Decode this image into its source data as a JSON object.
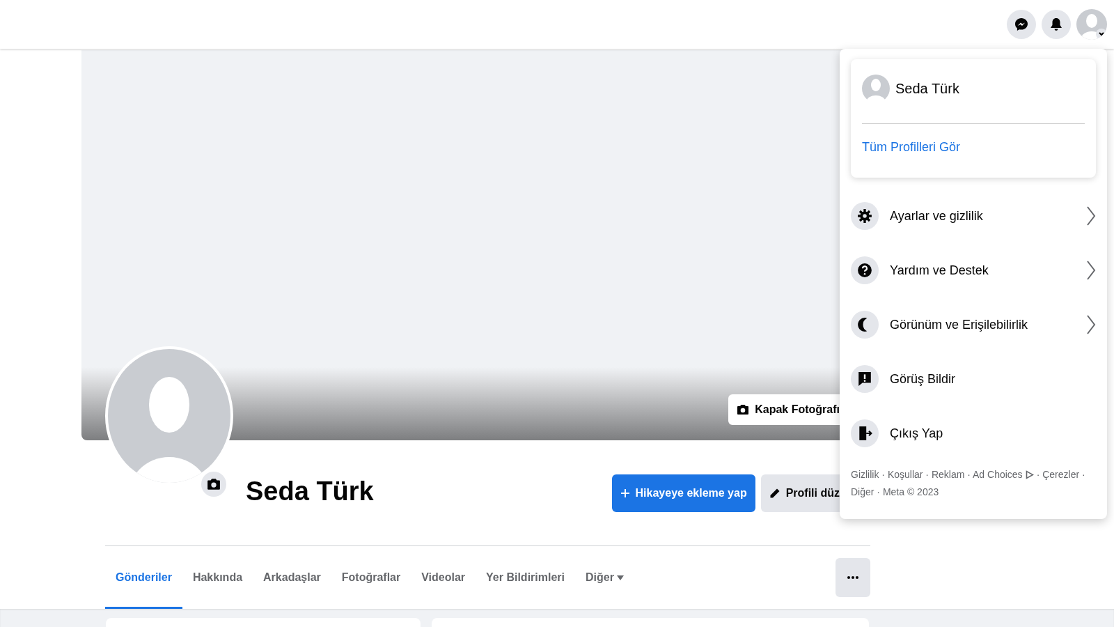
{
  "cover": {
    "button": "Kapak Fotoğrafı"
  },
  "profile": {
    "name": "Seda Türk",
    "buttons": [
      {
        "kind": "primary",
        "label": "Hikayeye ekleme yap"
      },
      {
        "kind": "secondary",
        "label": "Profili düz"
      }
    ]
  },
  "tabs": [
    {
      "label": "Gönderiler",
      "selected": true
    },
    {
      "label": "Hakkında",
      "selected": false
    },
    {
      "label": "Arkadaşlar",
      "selected": false
    },
    {
      "label": "Fotoğraflar",
      "selected": false
    },
    {
      "label": "Videolar",
      "selected": false
    },
    {
      "label": "Yer Bildirimleri",
      "selected": false
    },
    {
      "label": "Diğer",
      "selected": false,
      "dropdown": true
    }
  ],
  "account_menu": {
    "profile_name": "Seda Türk",
    "see_all": "Tüm Profilleri Gör",
    "items": [
      {
        "label": "Ayarlar ve gizlilik",
        "kind": "settings",
        "submenu": true
      },
      {
        "label": "Yardım ve Destek",
        "kind": "help",
        "submenu": true
      },
      {
        "label": "Görünüm ve Erişilebilirlik",
        "kind": "display",
        "submenu": true
      },
      {
        "label": "Görüş Bildir",
        "kind": "feedback",
        "submenu": false
      },
      {
        "label": "Çıkış Yap",
        "kind": "logout",
        "submenu": false
      }
    ],
    "footer": {
      "before_icon": "Gizlilik · Koşullar · Reklam · Ad Choices",
      "after_icon": "· Çerezler ·",
      "second_line": "Diğer · Meta © 2023"
    }
  }
}
